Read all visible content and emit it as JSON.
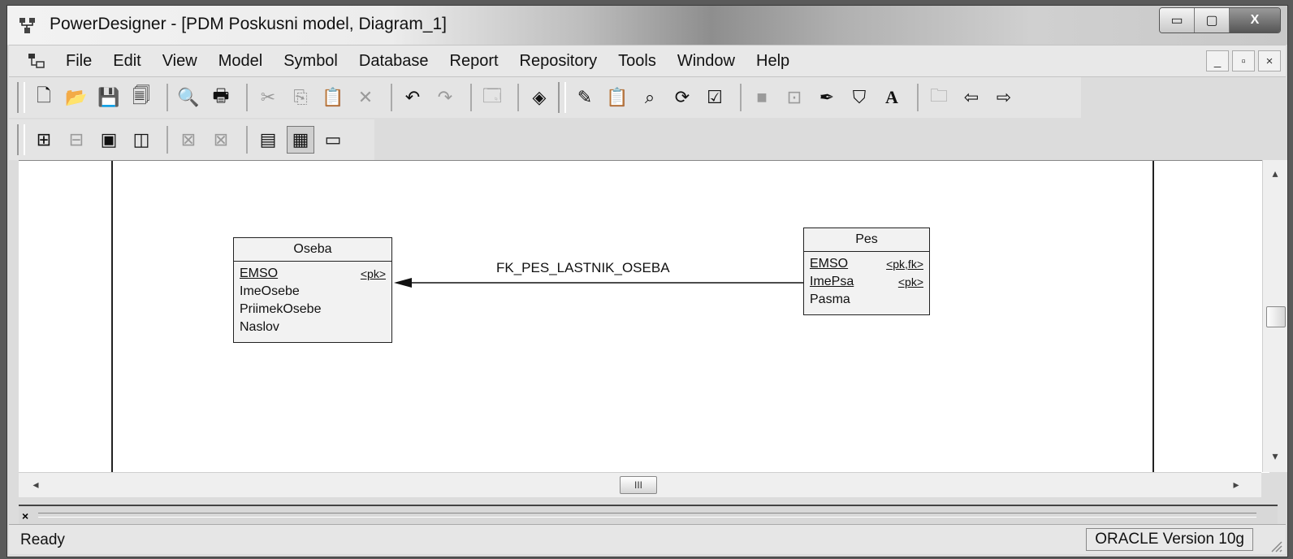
{
  "window": {
    "title": "PowerDesigner - [PDM Poskusni model, Diagram_1]",
    "controls": {
      "minimize": "▭",
      "maximize": "▢",
      "close": "X"
    }
  },
  "menubar": {
    "items": [
      "File",
      "Edit",
      "View",
      "Model",
      "Symbol",
      "Database",
      "Report",
      "Repository",
      "Tools",
      "Window",
      "Help"
    ],
    "mdi_controls": {
      "minimize": "_",
      "restore": "▫",
      "close": "×"
    }
  },
  "toolbar_standard": {
    "icons": [
      "new-icon",
      "open-icon",
      "save-icon",
      "save-all-icon",
      "print-preview-icon",
      "print-icon",
      "cut-icon",
      "copy-icon",
      "paste-icon",
      "delete-icon",
      "undo-icon",
      "redo-icon",
      "properties-icon",
      "model-check-icon",
      "edit-icon",
      "paste-as-shortcut-icon",
      "find-icon",
      "refresh-icon",
      "check-icon",
      "fill-icon",
      "text-field-icon",
      "line-style-icon",
      "fill-style-icon",
      "font-icon",
      "folder-icon",
      "back-icon",
      "forward-icon"
    ]
  },
  "toolbar_diagram": {
    "icons": [
      "diagram-icon",
      "grid-icon",
      "single-page-icon",
      "double-page-icon",
      "move-up-icon",
      "move-down-icon",
      "browser-icon",
      "output-icon",
      "result-list-icon"
    ]
  },
  "diagram": {
    "entities": [
      {
        "name": "Oseba",
        "columns": [
          {
            "name": "EMSO",
            "key": "<pk>",
            "underline": true
          },
          {
            "name": "ImeOsebe",
            "key": "",
            "underline": false
          },
          {
            "name": "PriimekOsebe",
            "key": "",
            "underline": false
          },
          {
            "name": "Naslov",
            "key": "",
            "underline": false
          }
        ]
      },
      {
        "name": "Pes",
        "columns": [
          {
            "name": "EMSO",
            "key": "<pk,fk>",
            "underline": true
          },
          {
            "name": "ImePsa",
            "key": "<pk>",
            "underline": true
          },
          {
            "name": "Pasma",
            "key": "",
            "underline": false
          }
        ]
      }
    ],
    "reference": {
      "label": "FK_PES_LASTNIK_OSEBA"
    }
  },
  "scrollbars": {
    "hthumb_grip": "III",
    "left_arrow": "◂",
    "right_arrow": "▸",
    "up_arrow": "▴",
    "down_arrow": "▾"
  },
  "bottom_pane": {
    "close": "×"
  },
  "status": {
    "left": "Ready",
    "right": "ORACLE Version 10g"
  }
}
